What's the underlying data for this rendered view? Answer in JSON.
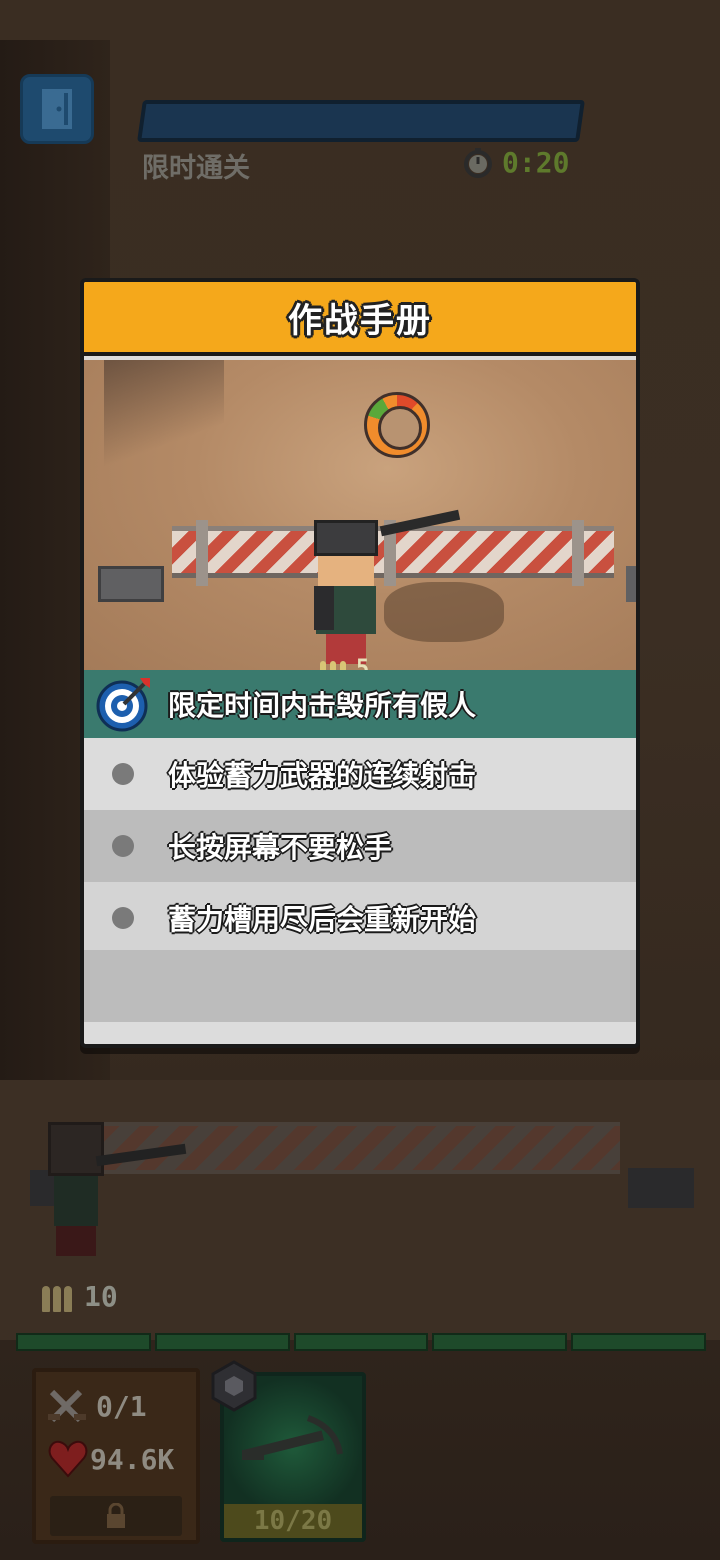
{
  "hud": {
    "mode_label": "限时通关",
    "timer": "0:20",
    "exit_icon": "exit-door-icon"
  },
  "dialog": {
    "title": "作战手册",
    "preview_ammo_count": "5",
    "goal": "限定时间内击毁所有假人",
    "tips": [
      "体验蓄力武器的连续射击",
      "长按屏幕不要松手",
      "蓄力槽用尽后会重新开始"
    ]
  },
  "scene": {
    "ammo_count": "10"
  },
  "bottom": {
    "kills": "0/1",
    "health": "94.6K",
    "weapon_ammo": "10/20"
  },
  "colors": {
    "header": "#f5a81b",
    "goal_row": "#3a7a6e",
    "accent_timer": "#5e7a2c"
  }
}
